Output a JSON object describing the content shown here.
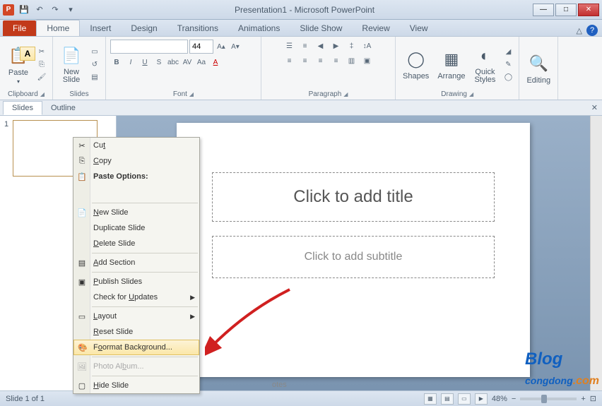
{
  "title": "Presentation1 - Microsoft PowerPoint",
  "app_letter": "P",
  "tabs": {
    "file": "File",
    "home": "Home",
    "insert": "Insert",
    "design": "Design",
    "transitions": "Transitions",
    "animations": "Animations",
    "slideshow": "Slide Show",
    "review": "Review",
    "view": "View"
  },
  "ribbon": {
    "clipboard": {
      "paste": "Paste",
      "label": "Clipboard"
    },
    "slides": {
      "new": "New\nSlide",
      "label": "Slides"
    },
    "font": {
      "size": "44",
      "label": "Font"
    },
    "paragraph": {
      "label": "Paragraph"
    },
    "drawing": {
      "shapes": "Shapes",
      "arrange": "Arrange",
      "quick": "Quick\nStyles",
      "label": "Drawing"
    },
    "editing": {
      "label": "Editing"
    }
  },
  "pane": {
    "slides": "Slides",
    "outline": "Outline",
    "thumb_num": "1"
  },
  "slide": {
    "title": "Click to add title",
    "subtitle": "Click to add subtitle",
    "notes": "otes"
  },
  "ctx": {
    "cut": "Cut",
    "copy": "Copy",
    "paste_opts": "Paste Options:",
    "new_slide": "ew Slide",
    "dup": "Duplicate Slide",
    "del": "elete Slide",
    "add_section": "dd Section",
    "publish": "ublish Slides",
    "check": "Check for ",
    "check2": "pdates",
    "layout": "ayout",
    "reset": "eset Slide",
    "format_bg": "ormat Background...",
    "album": "Photo Al",
    "album2": "um...",
    "hide": "ide Slide"
  },
  "status": {
    "slide": "Slide 1 of 1",
    "zoom": "48%"
  },
  "watermark": {
    "main": "Blog",
    "sub": "congdong",
    "com": ".com"
  }
}
